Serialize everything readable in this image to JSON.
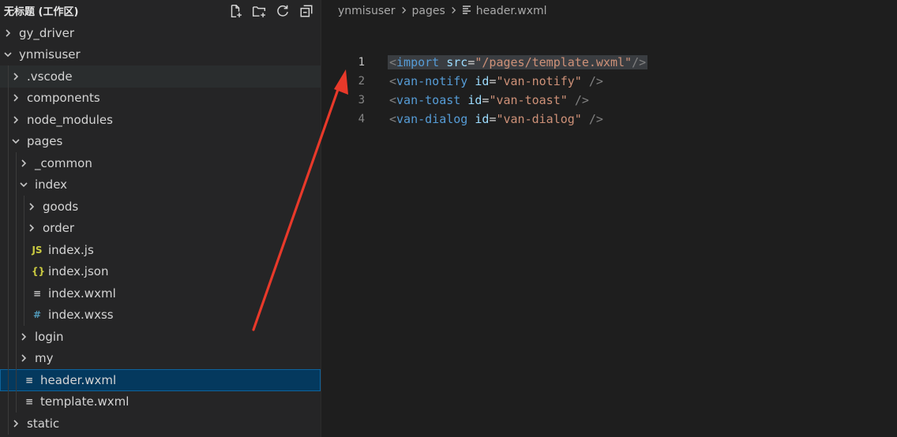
{
  "sidebar": {
    "title": "无标题 (工作区)",
    "actions": [
      {
        "name": "new-file-icon"
      },
      {
        "name": "new-folder-icon"
      },
      {
        "name": "refresh-icon"
      },
      {
        "name": "collapse-all-icon"
      }
    ],
    "items": [
      {
        "label": "gy_driver",
        "depth": 0,
        "kind": "folder",
        "open": false
      },
      {
        "label": "ynmisuser",
        "depth": 0,
        "kind": "folder",
        "open": true
      },
      {
        "label": ".vscode",
        "depth": 1,
        "kind": "folder",
        "open": false,
        "state": "hover"
      },
      {
        "label": "components",
        "depth": 1,
        "kind": "folder",
        "open": false
      },
      {
        "label": "node_modules",
        "depth": 1,
        "kind": "folder",
        "open": false
      },
      {
        "label": "pages",
        "depth": 1,
        "kind": "folder",
        "open": true
      },
      {
        "label": "_common",
        "depth": 2,
        "kind": "folder",
        "open": false
      },
      {
        "label": "index",
        "depth": 2,
        "kind": "folder",
        "open": true
      },
      {
        "label": "goods",
        "depth": 3,
        "kind": "folder",
        "open": false
      },
      {
        "label": "order",
        "depth": 3,
        "kind": "folder",
        "open": false
      },
      {
        "label": "index.js",
        "depth": 3,
        "kind": "file",
        "icon": "js-file-icon",
        "glyph": "JS"
      },
      {
        "label": "index.json",
        "depth": 3,
        "kind": "file",
        "icon": "json-file-icon",
        "glyph": "{}"
      },
      {
        "label": "index.wxml",
        "depth": 3,
        "kind": "file",
        "icon": "wxml-file-icon",
        "glyph": "≡"
      },
      {
        "label": "index.wxss",
        "depth": 3,
        "kind": "file",
        "icon": "wxss-file-icon",
        "glyph": "#"
      },
      {
        "label": "login",
        "depth": 2,
        "kind": "folder",
        "open": false
      },
      {
        "label": "my",
        "depth": 2,
        "kind": "folder",
        "open": false
      },
      {
        "label": "header.wxml",
        "depth": 2,
        "kind": "file",
        "icon": "wxml-file-icon",
        "glyph": "≡",
        "state": "selected"
      },
      {
        "label": "template.wxml",
        "depth": 2,
        "kind": "file",
        "icon": "wxml-file-icon",
        "glyph": "≡"
      },
      {
        "label": "static",
        "depth": 1,
        "kind": "folder",
        "open": false
      }
    ]
  },
  "editor": {
    "breadcrumb": [
      "ynmisuser",
      "pages",
      "header.wxml"
    ],
    "lines": [
      {
        "num": "1",
        "active": true,
        "tokens": [
          [
            "t-punc",
            "<"
          ],
          [
            "t-tag",
            "import"
          ],
          [
            "t-eq",
            " "
          ],
          [
            "t-attr",
            "src"
          ],
          [
            "t-eq",
            "="
          ],
          [
            "t-str",
            "\"/pages/template.wxml\""
          ],
          [
            "t-punc",
            "/>"
          ]
        ]
      },
      {
        "num": "2",
        "tokens": [
          [
            "t-punc",
            "<"
          ],
          [
            "t-tag",
            "van-notify"
          ],
          [
            "t-eq",
            " "
          ],
          [
            "t-attr",
            "id"
          ],
          [
            "t-eq",
            "="
          ],
          [
            "t-str",
            "\"van-notify\""
          ],
          [
            "t-eq",
            " "
          ],
          [
            "t-punc",
            "/>"
          ]
        ]
      },
      {
        "num": "3",
        "tokens": [
          [
            "t-punc",
            "<"
          ],
          [
            "t-tag",
            "van-toast"
          ],
          [
            "t-eq",
            " "
          ],
          [
            "t-attr",
            "id"
          ],
          [
            "t-eq",
            "="
          ],
          [
            "t-str",
            "\"van-toast\""
          ],
          [
            "t-eq",
            " "
          ],
          [
            "t-punc",
            "/>"
          ]
        ]
      },
      {
        "num": "4",
        "tokens": [
          [
            "t-punc",
            "<"
          ],
          [
            "t-tag",
            "van-dialog"
          ],
          [
            "t-eq",
            " "
          ],
          [
            "t-attr",
            "id"
          ],
          [
            "t-eq",
            "="
          ],
          [
            "t-str",
            "\"van-dialog\""
          ],
          [
            "t-eq",
            " "
          ],
          [
            "t-punc",
            "/>"
          ]
        ]
      }
    ]
  },
  "annotation": {
    "color": "#e8392a"
  }
}
